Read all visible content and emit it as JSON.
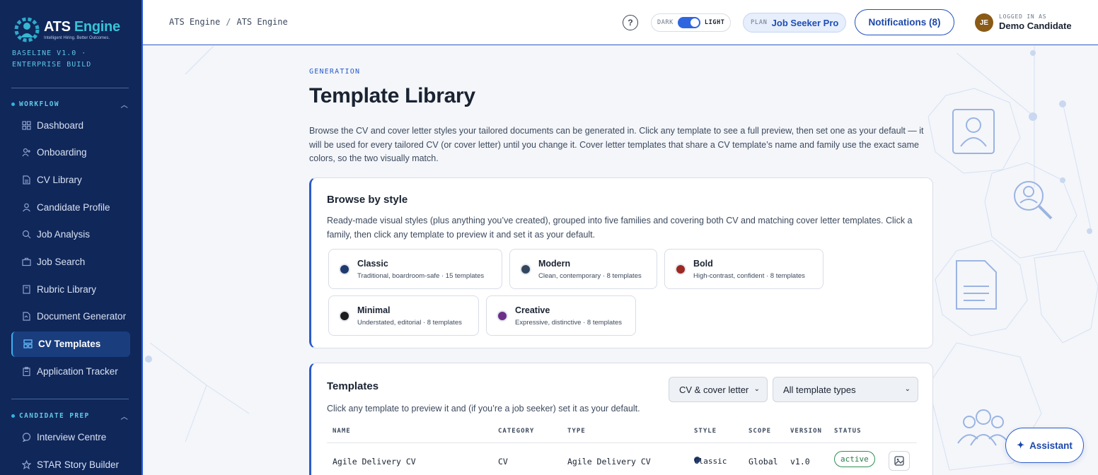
{
  "app": {
    "logo_name_1": "ATS",
    "logo_name_2": "Engine",
    "logo_tagline": "Intelligent Hiring. Better Outcomes.",
    "build_line_1": "BASELINE V1.0 ·",
    "build_line_2": "ENTERPRISE BUILD"
  },
  "sidebar": {
    "workflow_title": "WORKFLOW",
    "workflow_items": [
      {
        "label": "Dashboard",
        "icon": "dashboard-icon"
      },
      {
        "label": "Onboarding",
        "icon": "user-plus-icon"
      },
      {
        "label": "CV Library",
        "icon": "document-icon"
      },
      {
        "label": "Candidate Profile",
        "icon": "user-icon"
      },
      {
        "label": "Job Analysis",
        "icon": "search-icon"
      },
      {
        "label": "Job Search",
        "icon": "briefcase-icon"
      },
      {
        "label": "Rubric Library",
        "icon": "book-icon"
      },
      {
        "label": "Document Generator",
        "icon": "file-generate-icon"
      },
      {
        "label": "CV Templates",
        "icon": "layout-icon",
        "active": true
      },
      {
        "label": "Application Tracker",
        "icon": "clipboard-icon"
      }
    ],
    "prep_title": "CANDIDATE PREP",
    "prep_items": [
      {
        "label": "Interview Centre",
        "icon": "chat-icon"
      },
      {
        "label": "STAR Story Builder",
        "icon": "star-icon"
      }
    ]
  },
  "header": {
    "breadcrumb": [
      "ATS Engine",
      "ATS Engine"
    ],
    "breadcrumb_sep": "/",
    "help": "?",
    "theme_dark": "DARK",
    "theme_light": "LIGHT",
    "plan_label": "PLAN",
    "plan_value": "Job Seeker Pro",
    "notifications": "Notifications (8)",
    "avatar_initials": "JE",
    "logged_in_label": "LOGGED IN AS",
    "user_name": "Demo Candidate"
  },
  "page": {
    "eyebrow": "GENERATION",
    "title": "Template Library",
    "intro": "Browse the CV and cover letter styles your tailored documents can be generated in. Click any template to see a full preview, then set one as your default — it will be used for every tailored CV (or cover letter) until you change it. Cover letter templates that share a CV template’s name and family use the exact same colors, so the two visually match."
  },
  "browse": {
    "title": "Browse by style",
    "description": "Ready-made visual styles (plus anything you’ve created), grouped into five families and covering both CV and matching cover letter templates. Click a family, then click any template to preview it and set it as your default.",
    "families": [
      {
        "name": "Classic",
        "sub": "Traditional, boardroom-safe · 15 templates",
        "color": "#1f3a6e"
      },
      {
        "name": "Modern",
        "sub": "Clean, contemporary · 8 templates",
        "color": "#34465e"
      },
      {
        "name": "Bold",
        "sub": "High-contrast, confident · 8 templates",
        "color": "#9a2a22"
      },
      {
        "name": "Minimal",
        "sub": "Understated, editorial · 8 templates",
        "color": "#1d1d1d"
      },
      {
        "name": "Creative",
        "sub": "Expressive, distinctive · 8 templates",
        "color": "#6b2f8a"
      }
    ]
  },
  "templates": {
    "title": "Templates",
    "description": "Click any template to preview it and (if you’re a job seeker) set it as your default.",
    "filter_doc": "CV & cover letter",
    "filter_type": "All template types",
    "columns": [
      "NAME",
      "CATEGORY",
      "TYPE",
      "STYLE",
      "SCOPE",
      "VERSION",
      "STATUS"
    ],
    "rows": [
      {
        "name": "Agile Delivery CV",
        "category": "CV",
        "type": "Agile Delivery CV",
        "style": "Classic",
        "scope": "Global",
        "version": "v1.0",
        "status": "active"
      }
    ]
  },
  "assistant": "Assistant",
  "colors": {
    "sidebar_bg": "#10275a",
    "accent": "#2a5bc8",
    "active_status": "#2a7c48"
  }
}
